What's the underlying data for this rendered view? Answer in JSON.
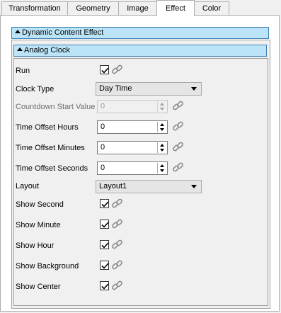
{
  "tabs": [
    {
      "label": "Transformation"
    },
    {
      "label": "Geometry"
    },
    {
      "label": "Image"
    },
    {
      "label": "Effect"
    },
    {
      "label": "Color"
    }
  ],
  "active_tab": "Effect",
  "sections": {
    "dynamic": "Dynamic Content Effect",
    "analog": "Analog Clock"
  },
  "fields": {
    "run": {
      "label": "Run",
      "checked": true
    },
    "clock_type": {
      "label": "Clock Type",
      "value": "Day Time"
    },
    "countdown": {
      "label": "Countdown Start Value",
      "value": "0",
      "disabled": true
    },
    "offset_hours": {
      "label": "Time Offset Hours",
      "value": "0"
    },
    "offset_minutes": {
      "label": "Time Offset Minutes",
      "value": "0"
    },
    "offset_seconds": {
      "label": "Time Offset Seconds",
      "value": "0"
    },
    "layout": {
      "label": "Layout",
      "value": "Layout1"
    },
    "show_second": {
      "label": "Show Second",
      "checked": true
    },
    "show_minute": {
      "label": "Show Minute",
      "checked": true
    },
    "show_hour": {
      "label": "Show Hour",
      "checked": true
    },
    "show_background": {
      "label": "Show Background",
      "checked": true
    },
    "show_center": {
      "label": "Show Center",
      "checked": true
    }
  },
  "colors": {
    "header_bg": "#bce4f8",
    "header_border": "#3c7fb1"
  },
  "icons": {
    "link": "chain-link-icon",
    "collapse": "triangle-up-icon",
    "dropdown": "chevron-down-icon"
  }
}
